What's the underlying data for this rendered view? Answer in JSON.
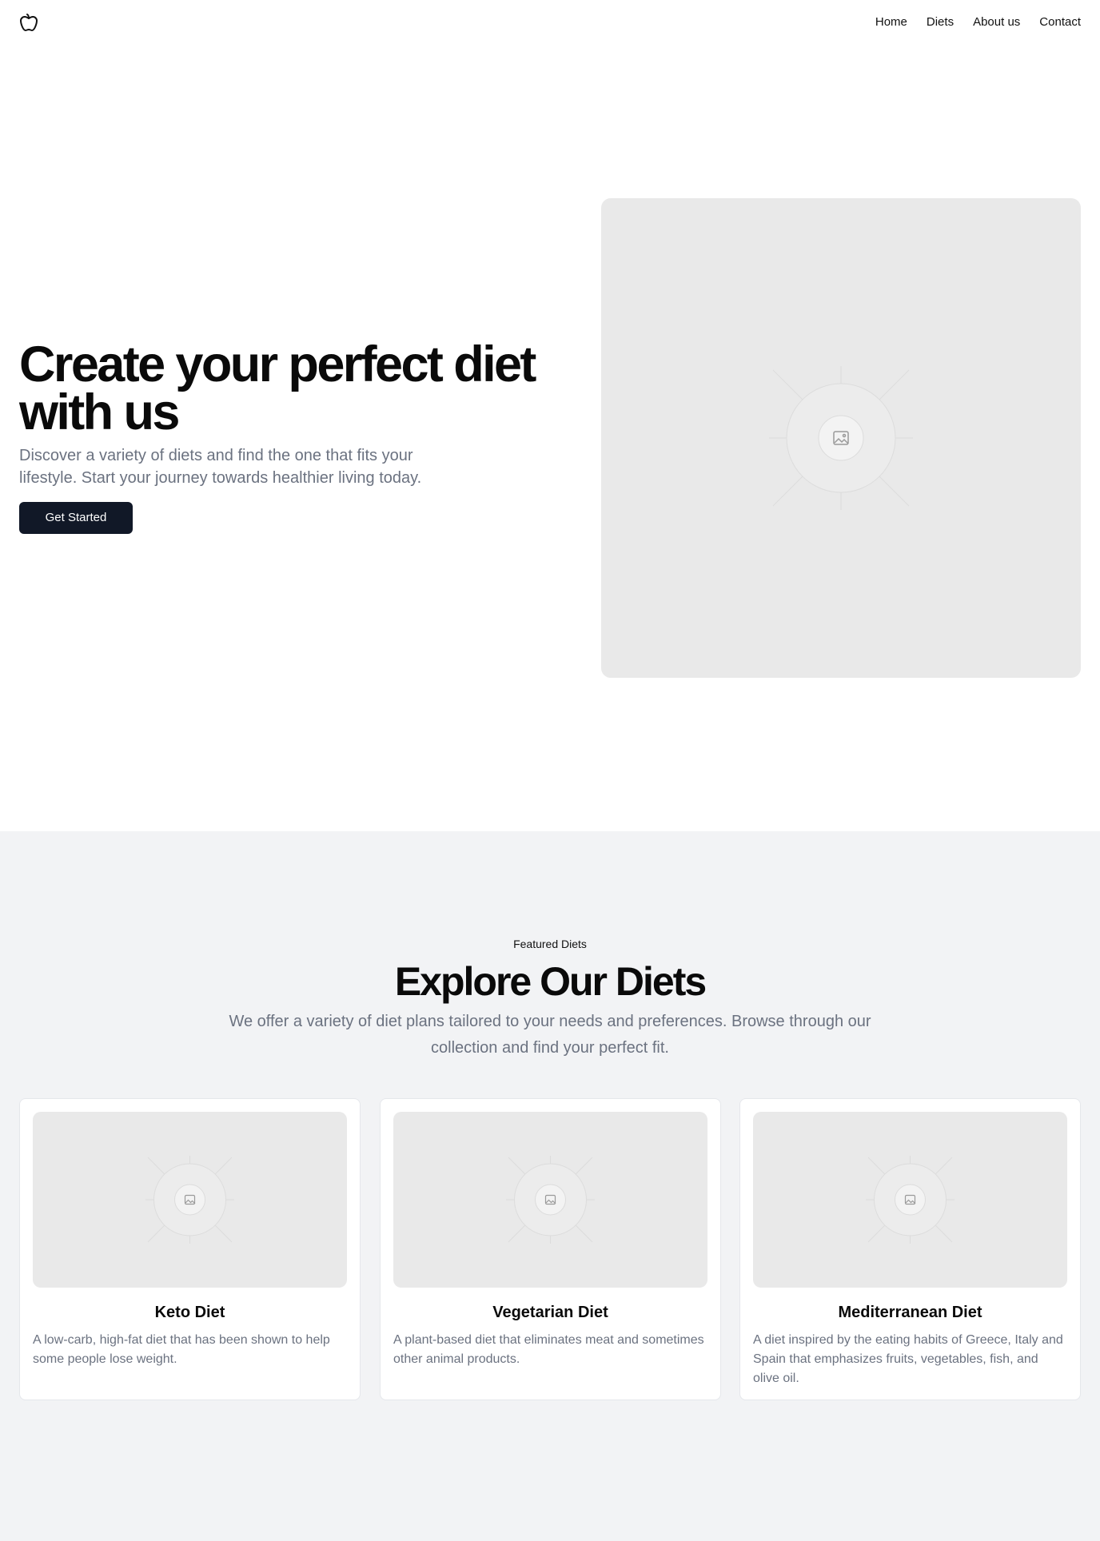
{
  "nav": {
    "logo_icon": "apple-icon",
    "items": [
      "Home",
      "Diets",
      "About us",
      "Contact"
    ]
  },
  "hero": {
    "title": "Create your perfect diet with us",
    "subtitle": "Discover a variety of diets and find the one that fits your lifestyle. Start your journey towards healthier living today.",
    "cta": "Get Started",
    "image_icon": "image-placeholder-icon"
  },
  "featured": {
    "eyebrow": "Featured Diets",
    "title": "Explore Our Diets",
    "subtitle": "We offer a variety of diet plans tailored to your needs and preferences. Browse through our collection and find your perfect fit.",
    "cards": [
      {
        "title": "Keto Diet",
        "description": "A low-carb, high-fat diet that has been shown to help some people lose weight."
      },
      {
        "title": "Vegetarian Diet",
        "description": "A plant-based diet that eliminates meat and sometimes other animal products."
      },
      {
        "title": "Mediterranean Diet",
        "description": "A diet inspired by the eating habits of Greece, Italy and Spain that emphasizes fruits, vegetables, fish, and olive oil."
      }
    ]
  },
  "colors": {
    "button_bg": "#111827",
    "section_bg": "#f2f3f5",
    "muted_text": "#6b7280",
    "placeholder_bg": "#e9e9e9"
  }
}
